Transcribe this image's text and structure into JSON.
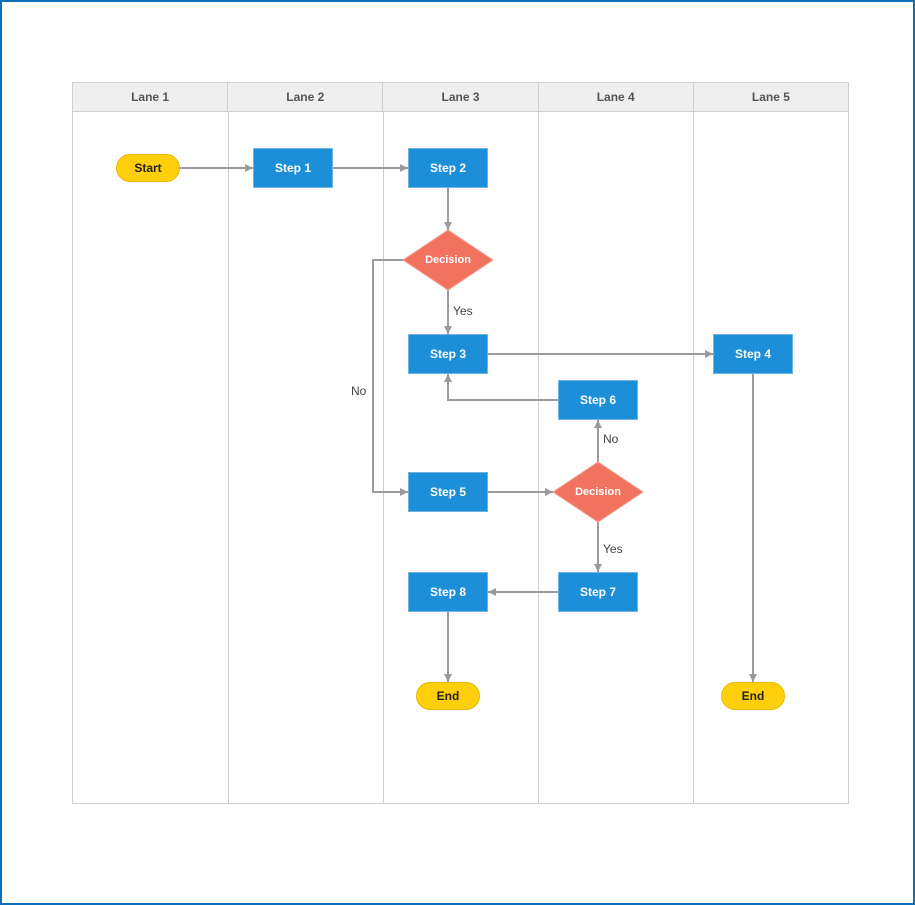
{
  "lanes": [
    "Lane 1",
    "Lane 2",
    "Lane 3",
    "Lane 4",
    "Lane 5"
  ],
  "nodes": {
    "start": {
      "label": "Start"
    },
    "step1": {
      "label": "Step 1"
    },
    "step2": {
      "label": "Step 2"
    },
    "decision1": {
      "label": "Decision"
    },
    "step3": {
      "label": "Step 3"
    },
    "step4": {
      "label": "Step 4"
    },
    "step5": {
      "label": "Step 5"
    },
    "decision2": {
      "label": "Decision"
    },
    "step6": {
      "label": "Step 6"
    },
    "step7": {
      "label": "Step 7"
    },
    "step8": {
      "label": "Step 8"
    },
    "end1": {
      "label": "End"
    },
    "end2": {
      "label": "End"
    }
  },
  "edge_labels": {
    "d1_yes": "Yes",
    "d1_no": "No",
    "d2_yes": "Yes",
    "d2_no": "No"
  },
  "chart_data": {
    "type": "flowchart_swimlane",
    "lanes": [
      "Lane 1",
      "Lane 2",
      "Lane 3",
      "Lane 4",
      "Lane 5"
    ],
    "nodes": [
      {
        "id": "start",
        "type": "terminator",
        "lane": "Lane 1",
        "label": "Start"
      },
      {
        "id": "step1",
        "type": "process",
        "lane": "Lane 2",
        "label": "Step 1"
      },
      {
        "id": "step2",
        "type": "process",
        "lane": "Lane 3",
        "label": "Step 2"
      },
      {
        "id": "decision1",
        "type": "decision",
        "lane": "Lane 3",
        "label": "Decision"
      },
      {
        "id": "step3",
        "type": "process",
        "lane": "Lane 3",
        "label": "Step 3"
      },
      {
        "id": "step4",
        "type": "process",
        "lane": "Lane 5",
        "label": "Step 4"
      },
      {
        "id": "step5",
        "type": "process",
        "lane": "Lane 3",
        "label": "Step 5"
      },
      {
        "id": "decision2",
        "type": "decision",
        "lane": "Lane 4",
        "label": "Decision"
      },
      {
        "id": "step6",
        "type": "process",
        "lane": "Lane 4",
        "label": "Step 6"
      },
      {
        "id": "step7",
        "type": "process",
        "lane": "Lane 4",
        "label": "Step 7"
      },
      {
        "id": "step8",
        "type": "process",
        "lane": "Lane 3",
        "label": "Step 8"
      },
      {
        "id": "end1",
        "type": "terminator",
        "lane": "Lane 3",
        "label": "End"
      },
      {
        "id": "end2",
        "type": "terminator",
        "lane": "Lane 5",
        "label": "End"
      }
    ],
    "edges": [
      {
        "from": "start",
        "to": "step1"
      },
      {
        "from": "step1",
        "to": "step2"
      },
      {
        "from": "step2",
        "to": "decision1"
      },
      {
        "from": "decision1",
        "to": "step3",
        "label": "Yes"
      },
      {
        "from": "decision1",
        "to": "step5",
        "label": "No"
      },
      {
        "from": "step3",
        "to": "step4"
      },
      {
        "from": "step4",
        "to": "end2"
      },
      {
        "from": "step5",
        "to": "decision2"
      },
      {
        "from": "decision2",
        "to": "step6",
        "label": "No"
      },
      {
        "from": "decision2",
        "to": "step7",
        "label": "Yes"
      },
      {
        "from": "step6",
        "to": "step3"
      },
      {
        "from": "step7",
        "to": "step8"
      },
      {
        "from": "step8",
        "to": "end1"
      }
    ]
  }
}
